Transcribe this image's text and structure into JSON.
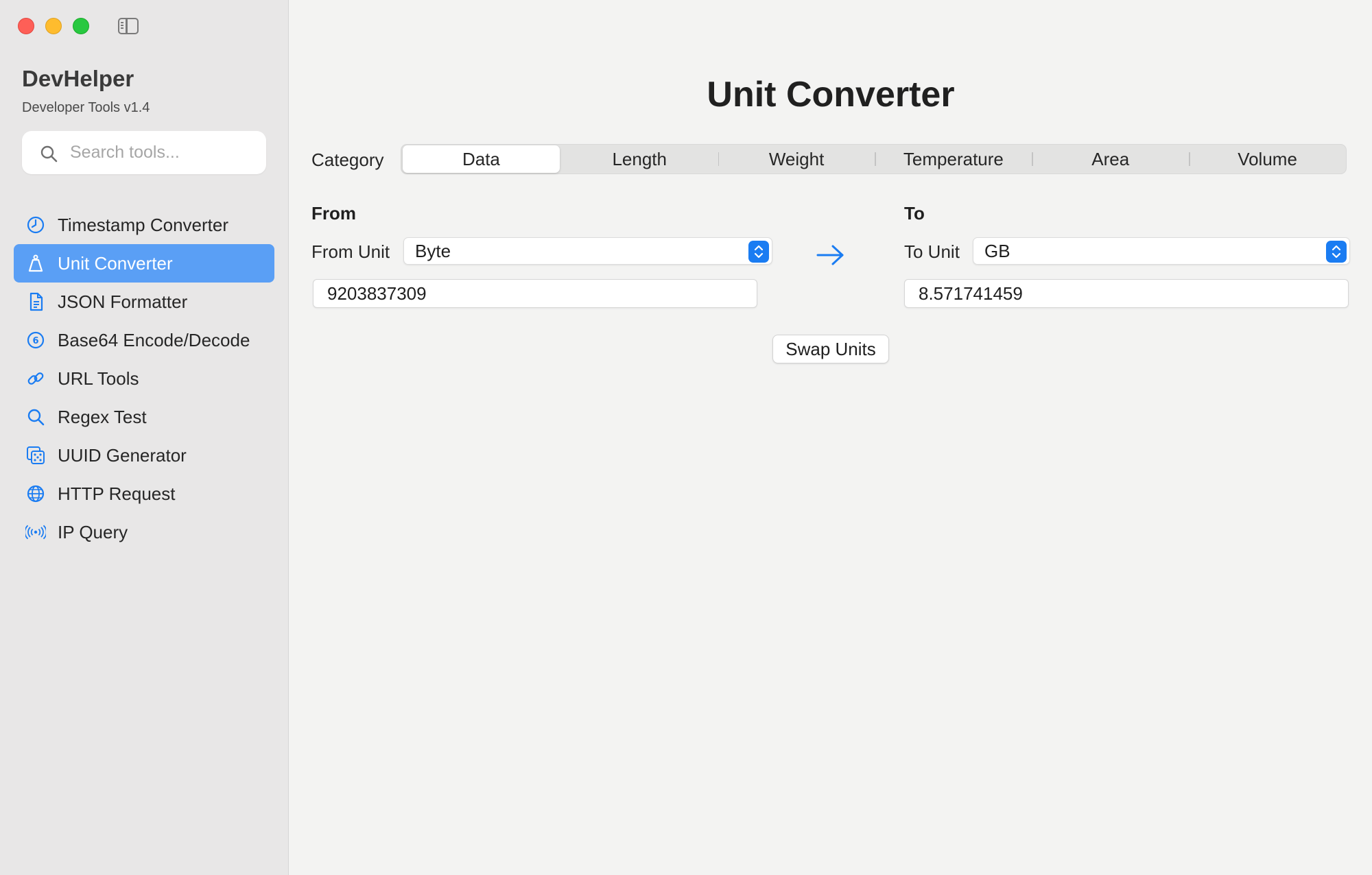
{
  "app": {
    "title": "DevHelper",
    "subtitle": "Developer Tools v1.4"
  },
  "search": {
    "placeholder": "Search tools..."
  },
  "sidebar": {
    "items": [
      {
        "label": "Timestamp Converter",
        "icon": "clock-icon"
      },
      {
        "label": "Unit Converter",
        "icon": "scale-icon",
        "active": true
      },
      {
        "label": "JSON Formatter",
        "icon": "document-icon"
      },
      {
        "label": "Base64 Encode/Decode",
        "icon": "number-six-circle-icon"
      },
      {
        "label": "URL Tools",
        "icon": "link-icon"
      },
      {
        "label": "Regex Test",
        "icon": "magnifier-icon"
      },
      {
        "label": "UUID Generator",
        "icon": "dice-icon"
      },
      {
        "label": "HTTP Request",
        "icon": "globe-icon"
      },
      {
        "label": "IP Query",
        "icon": "antenna-icon"
      }
    ]
  },
  "main": {
    "title": "Unit Converter",
    "category_label": "Category",
    "categories": [
      "Data",
      "Length",
      "Weight",
      "Temperature",
      "Area",
      "Volume"
    ],
    "selected_category": "Data",
    "from": {
      "section_title": "From",
      "unit_label": "From Unit",
      "unit_value": "Byte",
      "value": "9203837309"
    },
    "to": {
      "section_title": "To",
      "unit_label": "To Unit",
      "unit_value": "GB",
      "value": "8.571741459"
    },
    "swap_label": "Swap Units"
  },
  "colors": {
    "accent": "#1a7cf2",
    "sidebar_selection": "#5a9ff5",
    "close": "#fe5f57",
    "minimize": "#febc2e",
    "maximize": "#28c840"
  }
}
